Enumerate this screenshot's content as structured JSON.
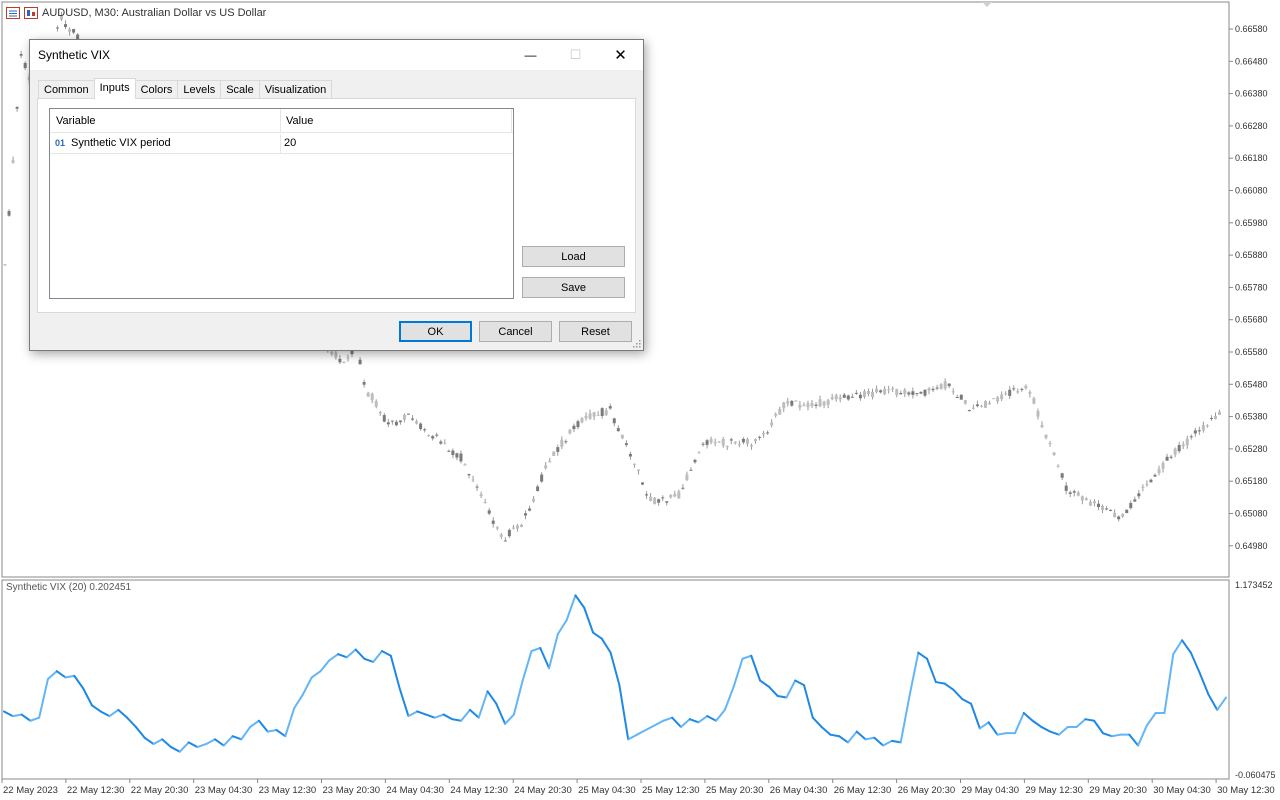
{
  "chart": {
    "symbol_title": "AUDUSD, M30:  Australian Dollar vs US Dollar",
    "price_labels": [
      "0.66580",
      "0.66480",
      "0.66380",
      "0.66280",
      "0.66180",
      "0.66080",
      "0.65980",
      "0.65880",
      "0.65780",
      "0.65680",
      "0.65580",
      "0.65480",
      "0.65380",
      "0.65280",
      "0.65180",
      "0.65080",
      "0.64980"
    ],
    "time_labels": [
      "22 May 2023",
      "22 May 12:30",
      "22 May 20:30",
      "23 May 04:30",
      "23 May 12:30",
      "23 May 20:30",
      "24 May 04:30",
      "24 May 12:30",
      "24 May 20:30",
      "25 May 04:30",
      "25 May 12:30",
      "25 May 20:30",
      "26 May 04:30",
      "26 May 12:30",
      "26 May 20:30",
      "29 May 04:30",
      "29 May 12:30",
      "29 May 20:30",
      "30 May 04:30",
      "30 May 12:30"
    ],
    "candle_color": "#9a9a9a",
    "background": "#ffffff"
  },
  "indicator": {
    "title": "Synthetic VIX (20) 0.202451",
    "scale_max": "1.173452",
    "scale_min": "-0.060475",
    "line_color_up": "#1e88e5",
    "line_color_down": "#64b5f6"
  },
  "chart_data": {
    "type": "line",
    "title": "Synthetic VIX (20) 0.202451",
    "ylim": [
      -0.060475,
      1.173452
    ],
    "x_tick_labels": [
      "22 May 2023",
      "22 May 12:30",
      "22 May 20:30",
      "23 May 04:30",
      "23 May 12:30",
      "23 May 20:30",
      "24 May 04:30",
      "24 May 12:30",
      "24 May 20:30",
      "25 May 04:30",
      "25 May 12:30",
      "25 May 20:30",
      "26 May 04:30",
      "26 May 12:30",
      "26 May 20:30",
      "29 May 04:30",
      "29 May 12:30",
      "29 May 20:30",
      "30 May 04:30",
      "30 May 12:30"
    ],
    "series": [
      {
        "values": [
          0.35,
          0.32,
          0.33,
          0.29,
          0.31,
          0.56,
          0.61,
          0.57,
          0.58,
          0.5,
          0.39,
          0.35,
          0.32,
          0.36,
          0.31,
          0.25,
          0.18,
          0.14,
          0.17,
          0.12,
          0.09,
          0.15,
          0.12,
          0.14,
          0.17,
          0.13,
          0.19,
          0.17,
          0.25,
          0.29,
          0.22,
          0.23,
          0.19,
          0.37,
          0.46,
          0.57,
          0.61,
          0.68,
          0.72,
          0.7,
          0.75,
          0.69,
          0.67,
          0.74,
          0.71,
          0.5,
          0.32,
          0.35,
          0.33,
          0.31,
          0.33,
          0.3,
          0.29,
          0.36,
          0.31,
          0.48,
          0.4,
          0.27,
          0.33,
          0.55,
          0.74,
          0.76,
          0.63,
          0.85,
          0.94,
          1.1,
          1.02,
          0.86,
          0.82,
          0.73,
          0.52,
          0.17,
          0.2,
          0.23,
          0.26,
          0.29,
          0.31,
          0.25,
          0.3,
          0.28,
          0.32,
          0.29,
          0.36,
          0.51,
          0.69,
          0.71,
          0.55,
          0.51,
          0.45,
          0.44,
          0.55,
          0.52,
          0.31,
          0.25,
          0.2,
          0.19,
          0.15,
          0.22,
          0.17,
          0.18,
          0.13,
          0.16,
          0.15,
          0.45,
          0.73,
          0.69,
          0.54,
          0.53,
          0.49,
          0.43,
          0.4,
          0.24,
          0.28,
          0.2,
          0.21,
          0.21,
          0.34,
          0.29,
          0.25,
          0.22,
          0.2,
          0.25,
          0.25,
          0.3,
          0.29,
          0.21,
          0.19,
          0.2,
          0.2,
          0.13,
          0.26,
          0.34,
          0.34,
          0.72,
          0.81,
          0.73,
          0.6,
          0.46,
          0.36,
          0.44
        ]
      }
    ]
  },
  "dialog": {
    "title": "Synthetic VIX",
    "minimize_glyph": "—",
    "maximize_glyph": "☐",
    "close_glyph": "✕",
    "tabs": [
      "Common",
      "Inputs",
      "Colors",
      "Levels",
      "Scale",
      "Visualization"
    ],
    "active_tab": "Inputs",
    "grid": {
      "col_variable": "Variable",
      "col_value": "Value",
      "rows": [
        {
          "badge": "01",
          "name": "Synthetic VIX period",
          "value": "20"
        }
      ]
    },
    "load_label": "Load",
    "save_label": "Save",
    "ok_label": "OK",
    "cancel_label": "Cancel",
    "reset_label": "Reset"
  }
}
